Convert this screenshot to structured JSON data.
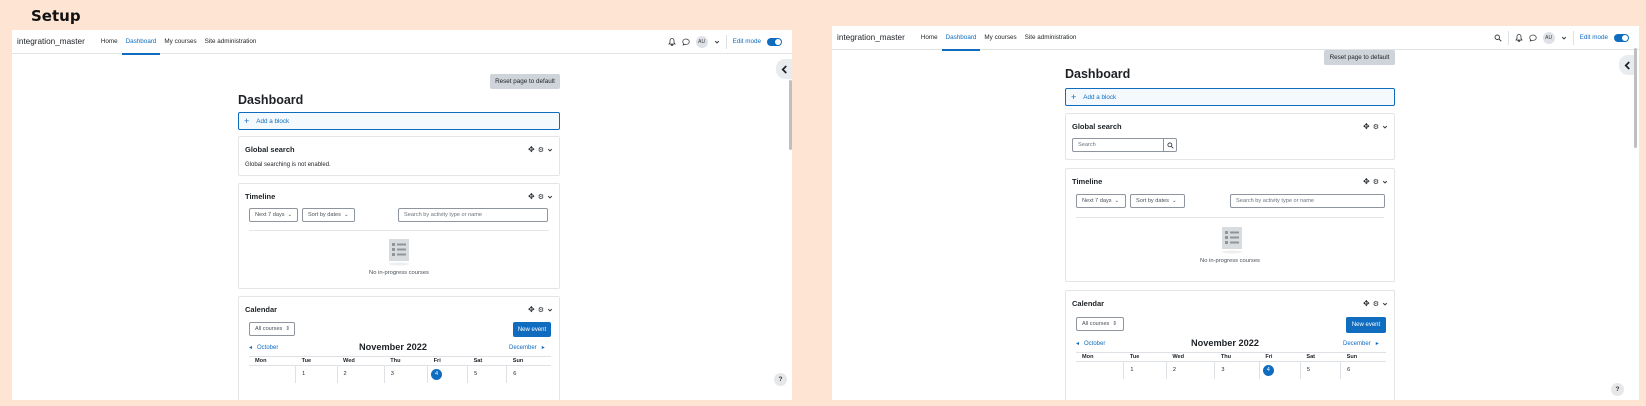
{
  "setup_title": "Setup",
  "brand": "integration_master",
  "nav": {
    "home": "Home",
    "dashboard": "Dashboard",
    "my_courses": "My courses",
    "site_admin": "Site administration"
  },
  "user_initials": "AU",
  "edit_mode": "Edit mode",
  "reset_page": "Reset page to default",
  "page_title": "Dashboard",
  "add_block": "Add a block",
  "global_search": {
    "title": "Global search",
    "disabled_message": "Global searching is not enabled.",
    "search_placeholder": "Search"
  },
  "timeline": {
    "title": "Timeline",
    "filter_days": "Next 7 days",
    "sort": "Sort by dates",
    "search_placeholder": "Search by activity type or name",
    "empty": "No in-progress courses"
  },
  "calendar": {
    "title": "Calendar",
    "course_filter": "All courses",
    "new_event": "New event",
    "month": "November 2022",
    "prev_month": "October",
    "next_month": "December",
    "weekdays": [
      "Mon",
      "Tue",
      "Wed",
      "Thu",
      "Fri",
      "Sat",
      "Sun"
    ],
    "first_week": [
      "",
      "1",
      "2",
      "3",
      "4",
      "5",
      "6"
    ],
    "today": "4"
  },
  "help": "?",
  "colors": {
    "background": "#fde4d3",
    "accent": "#0f6cbf"
  }
}
